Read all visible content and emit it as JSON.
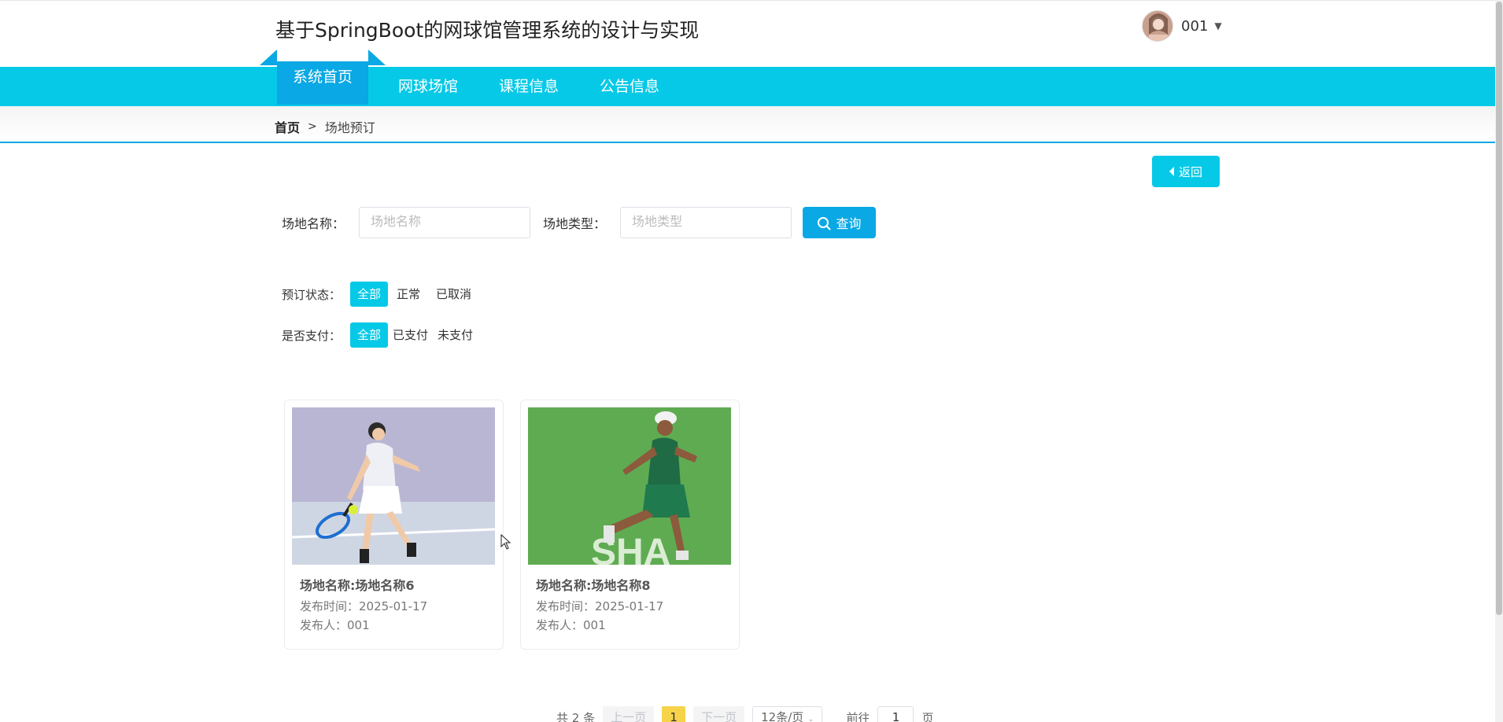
{
  "header": {
    "site_title": "基于SpringBoot的网球馆管理系统的设计与实现",
    "user_name": "001",
    "user_menu_icon": "caret-down-icon"
  },
  "nav": {
    "items": [
      {
        "label": "系统首页",
        "active": true
      },
      {
        "label": "网球场馆",
        "active": false
      },
      {
        "label": "课程信息",
        "active": false
      },
      {
        "label": "公告信息",
        "active": false
      }
    ]
  },
  "breadcrumb": {
    "home": "首页",
    "separator": ">",
    "current": "场地预订"
  },
  "back_button": {
    "label": "返回",
    "icon": "caret-left-icon"
  },
  "search": {
    "name_label": "场地名称：",
    "name_placeholder": "场地名称",
    "type_label": "场地类型：",
    "type_placeholder": "场地类型",
    "query_label": "查询",
    "query_icon": "search-icon"
  },
  "filters": {
    "status": {
      "label": "预订状态：",
      "options": [
        "全部",
        "正常",
        "已取消"
      ],
      "selected": "全部"
    },
    "paid": {
      "label": "是否支付：",
      "options": [
        "全部",
        "已支付",
        "未支付"
      ],
      "selected": "全部"
    }
  },
  "cards": [
    {
      "title": "场地名称:场地名称6",
      "publish_time": "发布时间：2025-01-17",
      "publisher": "发布人：001"
    },
    {
      "title": "场地名称:场地名称8",
      "publish_time": "发布时间：2025-01-17",
      "publisher": "发布人：001"
    }
  ],
  "pagination": {
    "total": "共 2 条",
    "prev": "上一页",
    "current_page": "1",
    "next": "下一页",
    "page_size": "12条/页",
    "goto_prefix": "前往",
    "goto_value": "1",
    "goto_suffix": "页"
  },
  "colors": {
    "nav_bg": "#06c9e7",
    "accent": "#0aa8e4",
    "active_page": "#f7d34a"
  }
}
